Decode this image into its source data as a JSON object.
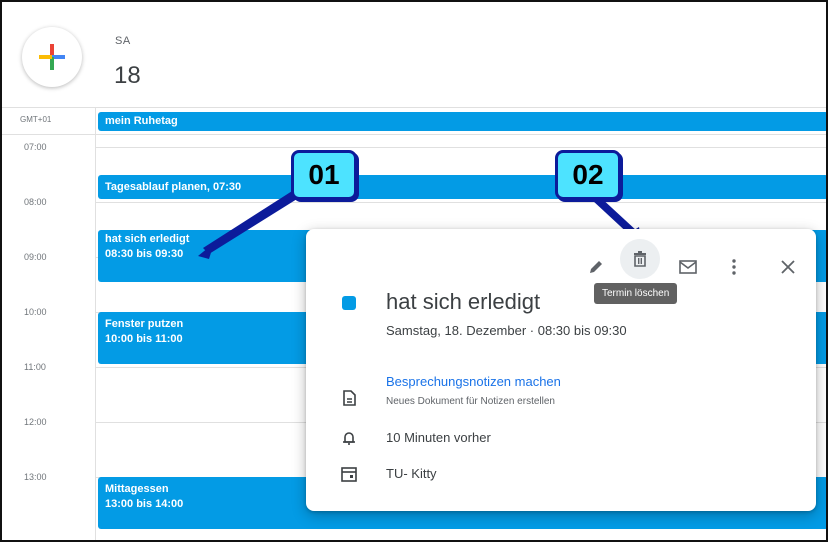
{
  "header": {
    "day_of_week": "SA",
    "day_number": "18"
  },
  "timezone": "GMT+01",
  "time_labels": [
    "07:00",
    "08:00",
    "09:00",
    "10:00",
    "11:00",
    "12:00",
    "13:00"
  ],
  "events": [
    {
      "title": "mein Ruhetag",
      "time": ""
    },
    {
      "title": "Tagesablauf planen, 07:30",
      "time": ""
    },
    {
      "title": "hat sich erledigt",
      "time": "08:30 bis 09:30"
    },
    {
      "title": "Fenster putzen",
      "time": "10:00 bis 11:00"
    },
    {
      "title": "Mittagessen",
      "time": "13:00 bis 14:00"
    }
  ],
  "callouts": [
    "01",
    "02"
  ],
  "popup": {
    "tooltip": "Termin löschen",
    "title": "hat sich erledigt",
    "date_line": "Samstag, 18. Dezember  ·  08:30 bis 09:30",
    "notes_link": "Besprechungsnotizen machen",
    "notes_sub": "Neues Dokument für Notizen erstellen",
    "reminder": "10 Minuten vorher",
    "calendar": "TU- Kitty"
  },
  "colors": {
    "event": "#039be5",
    "callout_fill": "#4de3ff",
    "callout_border": "#0c1b9a"
  }
}
